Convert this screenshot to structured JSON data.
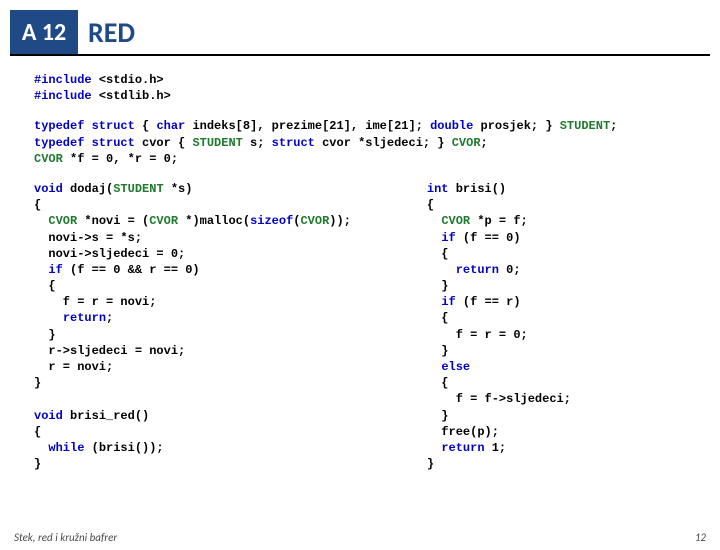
{
  "header": {
    "badge": "A 12",
    "title": "RED"
  },
  "code": {
    "includes": [
      {
        "pre": "#include",
        "hdr": "<stdio.h>"
      },
      {
        "pre": "#include",
        "hdr": "<stdlib.h>"
      }
    ],
    "typedef1_parts": {
      "kw1": "typedef struct",
      "open": " { ",
      "kw2": "char",
      "p1": " indeks[8], prezime[21], ime[21]; ",
      "kw3": "double",
      "p2": " prosjek; } ",
      "t1": "STUDENT",
      "end": ";"
    },
    "typedef2_parts": {
      "kw1": "typedef struct",
      "p1": " cvor { ",
      "t1": "STUDENT",
      "p2": " s; ",
      "kw2": "struct",
      "p3": " cvor *sljedeci; } ",
      "t2": "CVOR",
      "end": ";"
    },
    "globals_parts": {
      "t1": "CVOR",
      "rest": " *f = 0, *r = 0;"
    },
    "fn_dodaj": {
      "l1_kw": "void",
      "l1_name": " dodaj(",
      "l1_ty": "STUDENT",
      "l1_rest": " *s)",
      "l2": "{",
      "l3_ty": "CVOR",
      "l3_mid": " *novi = (",
      "l3_ty2": "CVOR",
      "l3_mid2": " *)malloc(",
      "l3_kw": "sizeof",
      "l3_rest": "(",
      "l3_ty3": "CVOR",
      "l3_end": "));",
      "l4": "  novi->s = *s;",
      "l5": "  novi->sljedeci = 0;",
      "l6_a": "  ",
      "l6_kw": "if",
      "l6_b": " (f == 0 && r == 0)",
      "l7": "  {",
      "l8": "    f = r = novi;",
      "l9_a": "    ",
      "l9_kw": "return",
      "l9_b": ";",
      "l10": "  }",
      "l11": "  r->sljedeci = novi;",
      "l12": "  r = novi;",
      "l13": "}"
    },
    "fn_brisi_red": {
      "l1_kw": "void",
      "l1_rest": " brisi_red()",
      "l2": "{",
      "l3_a": "  ",
      "l3_kw": "while",
      "l3_b": " (brisi());",
      "l4": "}"
    },
    "fn_brisi": {
      "l1_kw": "int",
      "l1_rest": " brisi()",
      "l2": "{",
      "l3_ty": "CVOR",
      "l3_rest": " *p = f;",
      "l4_a": "  ",
      "l4_kw": "if",
      "l4_b": " (f == 0)",
      "l5": "  {",
      "l6_a": "    ",
      "l6_kw": "return",
      "l6_b": " 0;",
      "l7": "  }",
      "l8_a": "  ",
      "l8_kw": "if",
      "l8_b": " (f == r)",
      "l9": "  {",
      "l10": "    f = r = 0;",
      "l11": "  }",
      "l12_a": "  ",
      "l12_kw": "else",
      "l13": "  {",
      "l14": "    f = f->sljedeci;",
      "l15": "  }",
      "l16": "  free(p);",
      "l17_a": "  ",
      "l17_kw": "return",
      "l17_b": " 1;",
      "l18": "}"
    }
  },
  "footer": {
    "left": "Stek, red i kružni bafrer",
    "right": "12"
  }
}
